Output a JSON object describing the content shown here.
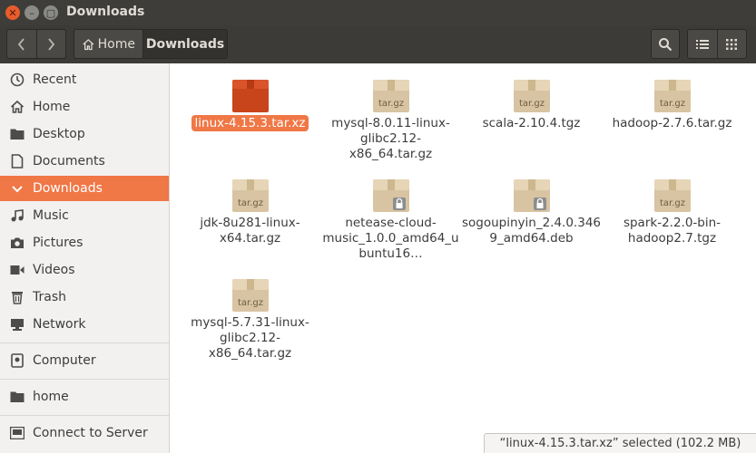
{
  "window": {
    "title": "Downloads"
  },
  "toolbar": {
    "back_glyph": "‹",
    "forward_glyph": "›",
    "crumb_home": "Home",
    "crumb_current": "Downloads"
  },
  "sidebar": {
    "items": [
      {
        "label": "Recent",
        "icon": "clock-icon"
      },
      {
        "label": "Home",
        "icon": "home-icon"
      },
      {
        "label": "Desktop",
        "icon": "folder-icon"
      },
      {
        "label": "Documents",
        "icon": "document-icon"
      },
      {
        "label": "Downloads",
        "icon": "download-icon",
        "active": true
      },
      {
        "label": "Music",
        "icon": "music-icon"
      },
      {
        "label": "Pictures",
        "icon": "camera-icon"
      },
      {
        "label": "Videos",
        "icon": "video-icon"
      },
      {
        "label": "Trash",
        "icon": "trash-icon"
      },
      {
        "label": "Network",
        "icon": "network-icon"
      },
      {
        "label": "Computer",
        "icon": "drive-icon"
      },
      {
        "label": "home",
        "icon": "folder-icon"
      },
      {
        "label": "Connect to Server",
        "icon": "server-icon"
      }
    ]
  },
  "files": [
    {
      "name": "linux-4.15.3.tar.xz",
      "type": "xz-archive",
      "selected": true
    },
    {
      "name": "mysql-8.0.11-linux-glibc2.12-x86_64.tar.gz",
      "type": "tar.gz"
    },
    {
      "name": "scala-2.10.4.tgz",
      "type": "tar.gz"
    },
    {
      "name": "hadoop-2.7.6.tar.gz",
      "type": "tar.gz"
    },
    {
      "name": "jdk-8u281-linux-x64.tar.gz",
      "type": "tar.gz"
    },
    {
      "name": "netease-cloud-music_1.0.0_amd64_ubuntu16…",
      "type": "deb"
    },
    {
      "name": "sogoupinyin_2.4.0.3469_amd64.deb",
      "type": "deb"
    },
    {
      "name": "spark-2.2.0-bin-hadoop2.7.tgz",
      "type": "tar.gz"
    },
    {
      "name": "mysql-5.7.31-linux-glibc2.12-x86_64.tar.gz",
      "type": "tar.gz"
    }
  ],
  "icon_label": "tar.gz",
  "status": {
    "text": "“linux-4.15.3.tar.xz” selected  (102.2 MB)"
  },
  "colors": {
    "accent": "#f07746",
    "titlebar": "#3e3d39",
    "close": "#e95c2c"
  }
}
